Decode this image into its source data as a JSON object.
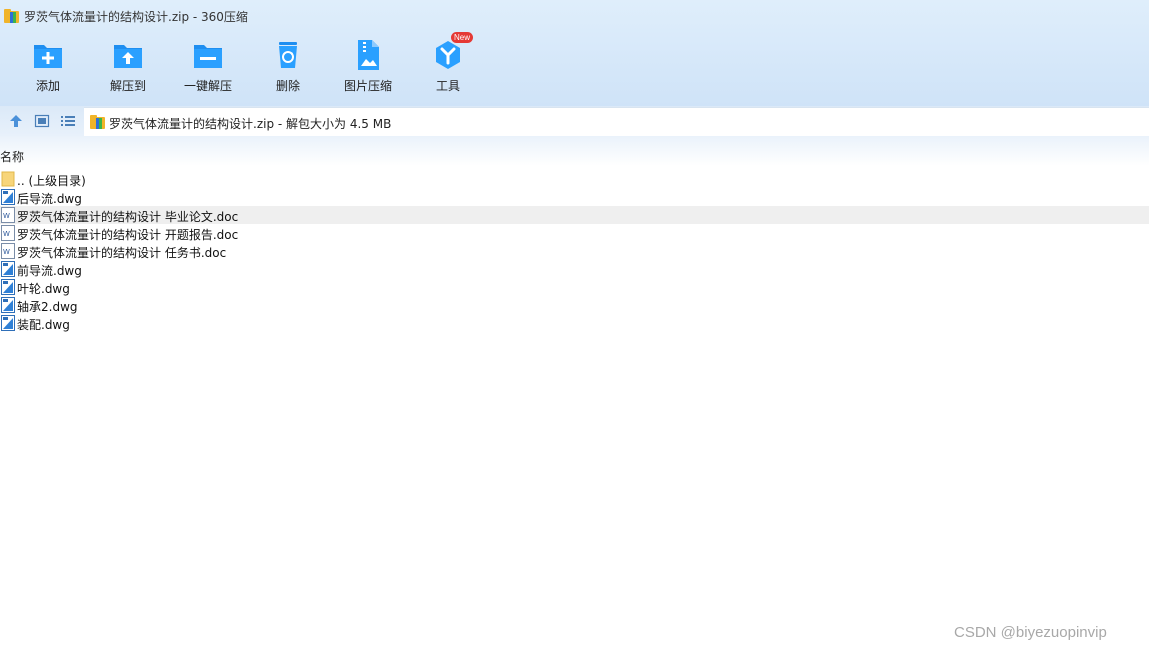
{
  "window": {
    "title": "罗茨气体流量计的结构设计.zip - 360压缩",
    "app_icon": "zip-archive-icon"
  },
  "toolbar": {
    "buttons": [
      {
        "label": "添加",
        "icon": "add-folder-icon"
      },
      {
        "label": "解压到",
        "icon": "extract-to-icon"
      },
      {
        "label": "一键解压",
        "icon": "one-click-extract-icon"
      },
      {
        "label": "删除",
        "icon": "recycle-bin-icon"
      },
      {
        "label": "图片压缩",
        "icon": "image-compress-icon"
      },
      {
        "label": "工具",
        "icon": "tools-icon",
        "badge": "New"
      }
    ]
  },
  "address": {
    "text": "罗茨气体流量计的结构设计.zip - 解包大小为 4.5 MB",
    "nav_icons": [
      "up-arrow-icon",
      "thumbnail-view-icon",
      "list-view-icon"
    ]
  },
  "columns": {
    "name": "名称"
  },
  "files": [
    {
      "name": ".. (上级目录)",
      "type": "folder"
    },
    {
      "name": "后导流.dwg",
      "type": "dwg"
    },
    {
      "name": "罗茨气体流量计的结构设计 毕业论文.doc",
      "type": "doc",
      "selected": true
    },
    {
      "name": "罗茨气体流量计的结构设计 开题报告.doc",
      "type": "doc"
    },
    {
      "name": "罗茨气体流量计的结构设计 任务书.doc",
      "type": "doc"
    },
    {
      "name": "前导流.dwg",
      "type": "dwg"
    },
    {
      "name": "叶轮.dwg",
      "type": "dwg"
    },
    {
      "name": "轴承2.dwg",
      "type": "dwg"
    },
    {
      "name": "装配.dwg",
      "type": "dwg"
    }
  ],
  "watermark": "CSDN @biyezuopinvip",
  "colors": {
    "accent": "#1e90ff",
    "toolbar_bg": "#d6e8fa",
    "selected_row": "#efefef",
    "badge": "#e53935"
  }
}
